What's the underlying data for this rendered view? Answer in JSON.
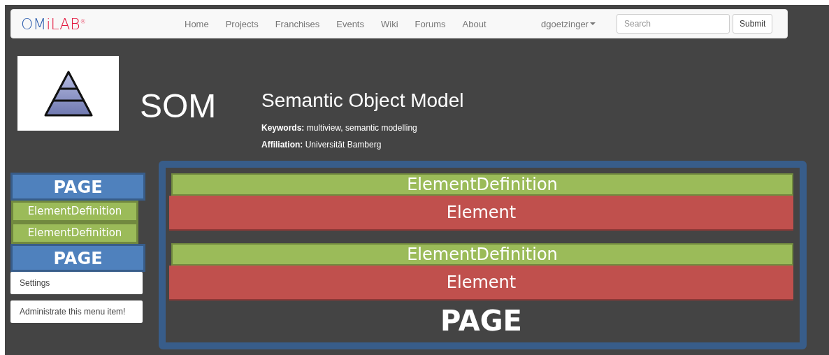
{
  "navbar": {
    "logo": [
      {
        "text": "OM",
        "color": "#2f5fae"
      },
      {
        "text": "iLAB",
        "color": "#e3173e"
      }
    ],
    "logo_mark": "®",
    "links": [
      "Home",
      "Projects",
      "Franchises",
      "Events",
      "Wiki",
      "Forums",
      "About"
    ],
    "user_menu": "dgoetzinger",
    "search": {
      "placeholder": "Search"
    },
    "submit": "Submit"
  },
  "project": {
    "acronym": "SOM",
    "title": "Semantic Object Model",
    "keywords": "**Keywords:** multiview, semantic modelling",
    "affiliation": "**Affiliation:** Universität Bamberg"
  },
  "sidebar": [
    {
      "kind": "page",
      "text": "PAGE"
    },
    {
      "kind": "definition",
      "text": "ElementDefinition"
    },
    {
      "kind": "definition",
      "text": "ElementDefinition"
    },
    {
      "kind": "page",
      "text": "PAGE"
    },
    {
      "kind": "menu",
      "text": "Settings"
    },
    {
      "kind": "menu",
      "text": "Administrate this menu item!"
    }
  ],
  "main": {
    "blocks": [
      {
        "definition": "ElementDefinition",
        "element": "Element"
      },
      {
        "definition": "ElementDefinition",
        "element": "Element"
      }
    ],
    "footer": "PAGE"
  }
}
